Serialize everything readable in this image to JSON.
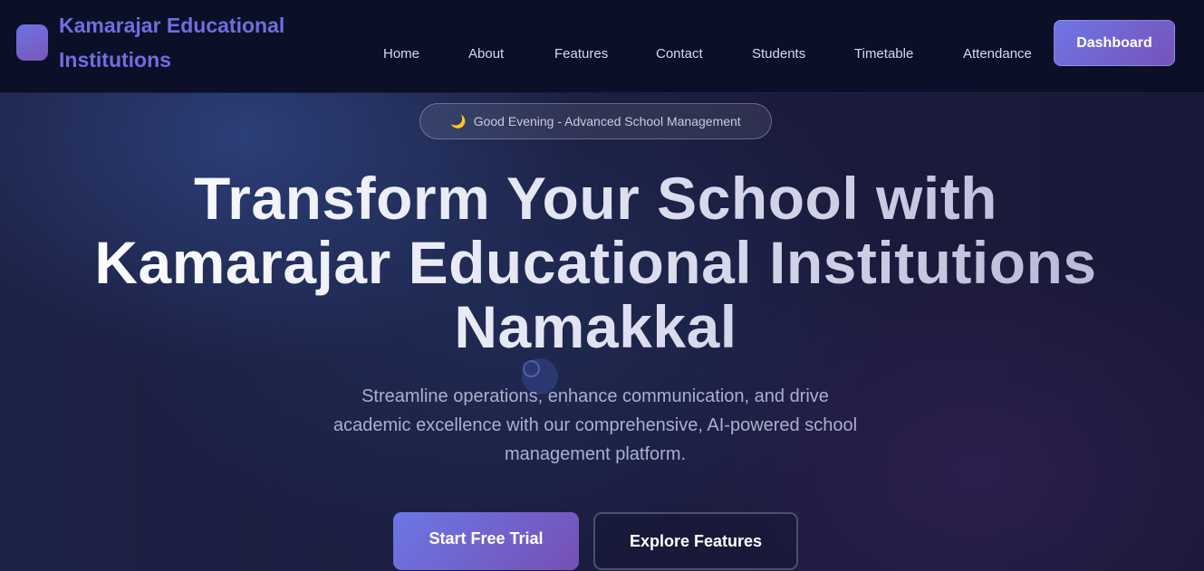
{
  "header": {
    "brand": "Kamarajar Educational Institutions",
    "nav": [
      "Home",
      "About",
      "Features",
      "Contact",
      "Students",
      "Timetable",
      "Attendance"
    ],
    "dashboard_label": "Dashboard"
  },
  "hero": {
    "badge_icon": "🌙",
    "badge_text": "Good Evening - Advanced School Management",
    "headline": "Transform Your School with Kamarajar Educational Institutions Namakkal",
    "subtitle": "Streamline operations, enhance communication, and drive academic excellence with our comprehensive, AI-powered school management platform.",
    "primary_button": "Start Free Trial",
    "secondary_button": "Explore Features"
  },
  "colors": {
    "brand": "#6f6fde",
    "button_gradient_start": "#6b77e6",
    "button_gradient_end": "#7650b4",
    "header_bg": "#0c0f28"
  },
  "icons": {
    "logo": "logo-mark-icon",
    "badge": "moon-icon"
  }
}
